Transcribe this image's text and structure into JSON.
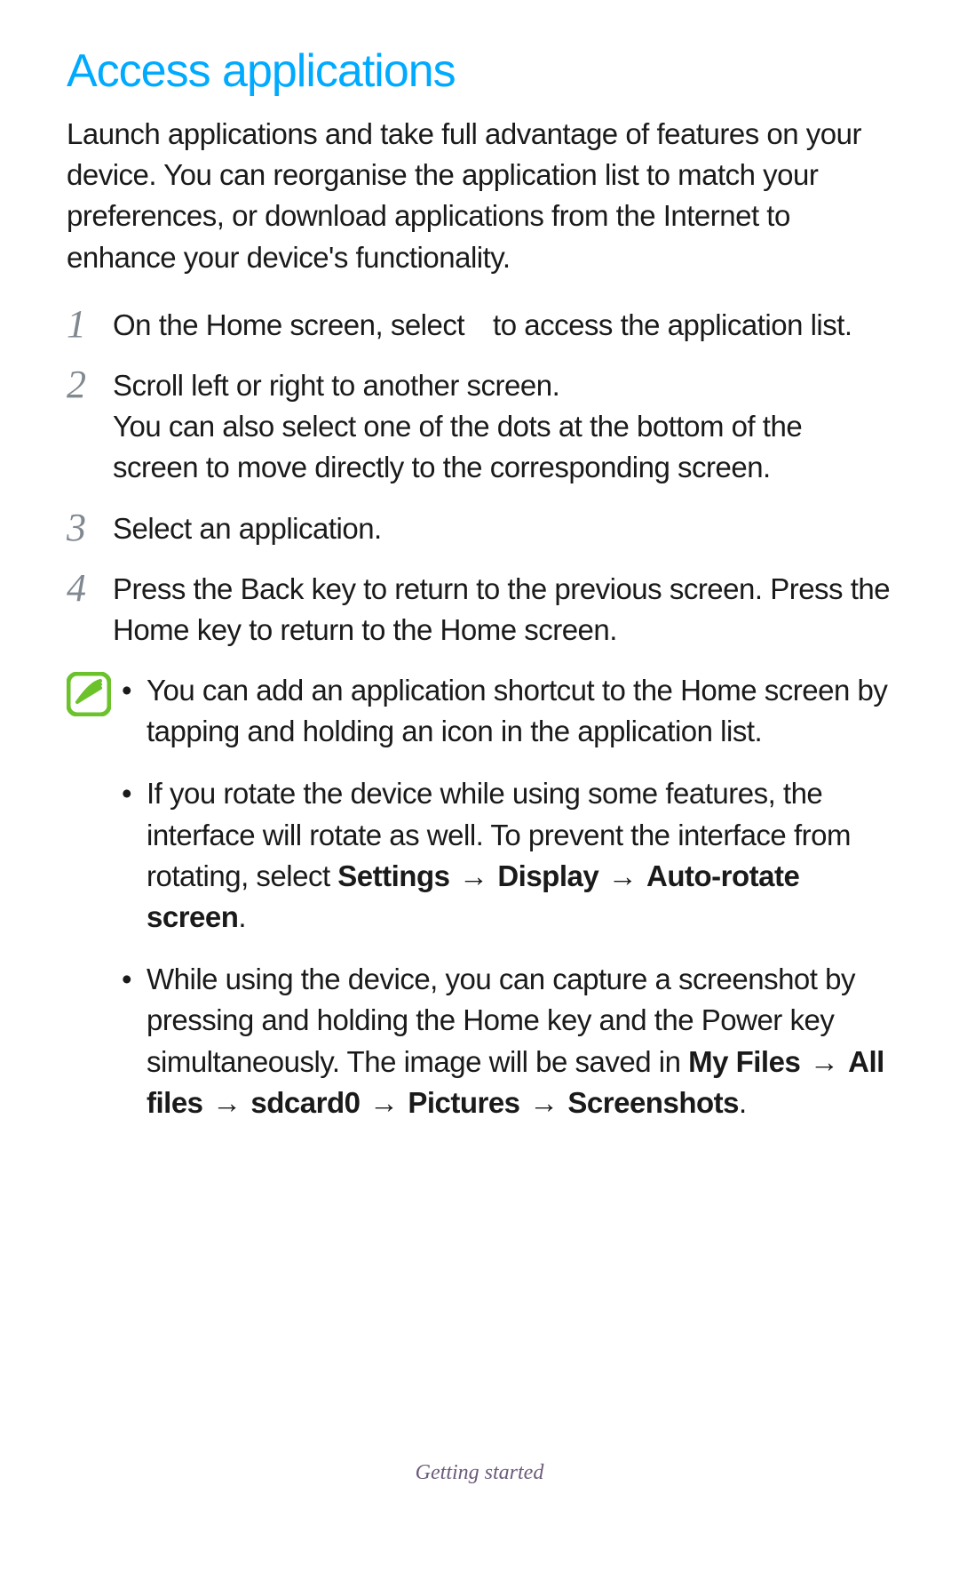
{
  "heading": "Access applications",
  "intro": "Launch applications and take full advantage of features on your device. You can reorganise the application list to match your preferences, or download applications from the Internet to enhance your device's functionality.",
  "steps": [
    {
      "num": "1",
      "text_before": "On the Home screen, select",
      "text_after": "to access the application list."
    },
    {
      "num": "2",
      "text_before": "Scroll left or right to another screen.",
      "text_after": "You can also select one of the dots at the bottom of the screen to move directly to the corresponding screen."
    },
    {
      "num": "3",
      "text_before": "Select an application.",
      "text_after": ""
    },
    {
      "num": "4",
      "text_before": "Press the Back key to return to the previous screen. Press the Home key to return to the Home screen.",
      "text_after": ""
    }
  ],
  "notes": [
    {
      "plain": "You can add an application shortcut to the Home screen by tapping and holding an icon in the application list."
    },
    {
      "lead": "If you rotate the device while using some features, the interface will rotate as well. To prevent the interface from rotating, select ",
      "bold_path": [
        "Settings",
        "Display",
        "Auto-rotate screen"
      ],
      "trail": "."
    },
    {
      "lead": "While using the device, you can capture a screenshot by pressing and holding the Home key and the Power key simultaneously. The image will be saved in ",
      "bold_path": [
        "My Files",
        "All files",
        "sdcard0",
        "Pictures",
        "Screenshots"
      ],
      "trail": "."
    }
  ],
  "arrow_glyph": "→",
  "bullet_glyph": "•",
  "footer": "Getting started"
}
